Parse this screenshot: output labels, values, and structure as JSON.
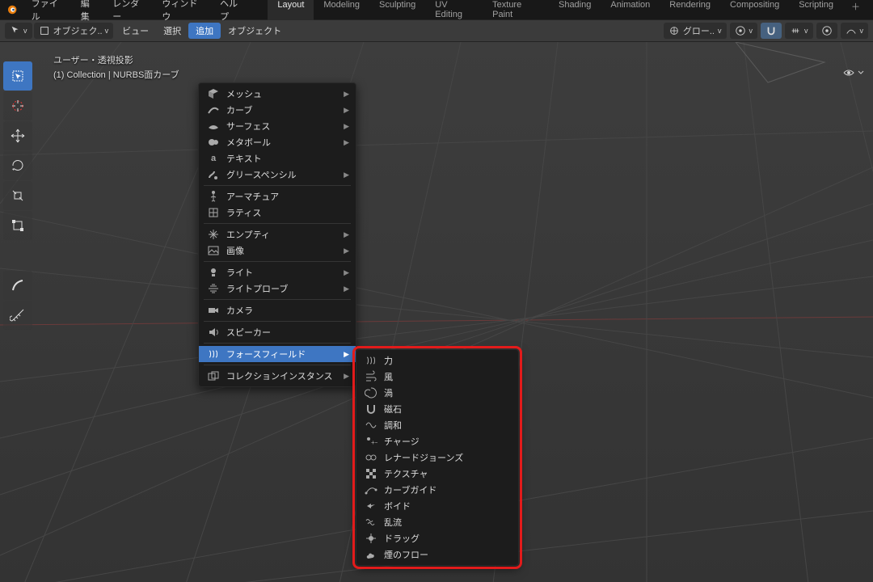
{
  "topmenu": {
    "file": "ファイル",
    "edit": "編集",
    "render": "レンダー",
    "window": "ウィンドウ",
    "help": "ヘルプ"
  },
  "workspaces": {
    "layout": "Layout",
    "modeling": "Modeling",
    "sculpting": "Sculpting",
    "uv": "UV Editing",
    "texpaint": "Texture Paint",
    "shading": "Shading",
    "anim": "Animation",
    "rendering": "Rendering",
    "comp": "Compositing",
    "script": "Scripting",
    "add": "＋"
  },
  "hdr": {
    "objmode": "オブジェク..",
    "view": "ビュー",
    "select": "選択",
    "add": "追加",
    "object": "オブジェクト",
    "global": "グロー..",
    "eye": "👁️"
  },
  "overlay": {
    "line1": "ユーザー・透視投影",
    "line2": "(1) Collection | NURBS面カーブ"
  },
  "addmenu": {
    "mesh": "メッシュ",
    "curve": "カーブ",
    "surface": "サーフェス",
    "metaball": "メタボール",
    "text": "テキスト",
    "gpencil": "グリースペンシル",
    "armature": "アーマチュア",
    "lattice": "ラティス",
    "empty": "エンプティ",
    "image": "画像",
    "light": "ライト",
    "lightprobe": "ライトプローブ",
    "camera": "カメラ",
    "speaker": "スピーカー",
    "forcefield": "フォースフィールド",
    "collection": "コレクションインスタンス"
  },
  "ff": {
    "force": "力",
    "wind": "風",
    "vortex": "渦",
    "magnet": "磁石",
    "harmonic": "調和",
    "charge": "チャージ",
    "lennard": "レナードジョーンズ",
    "texture": "テクスチャ",
    "curveguide": "カーブガイド",
    "boid": "ボイド",
    "turbulence": "乱流",
    "drag": "ドラッグ",
    "smoke": "煙のフロー"
  }
}
